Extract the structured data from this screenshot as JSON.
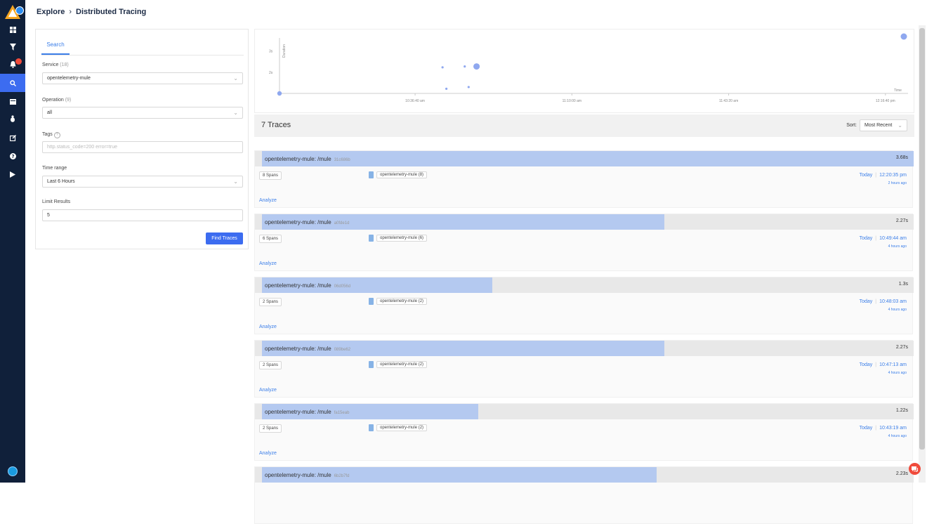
{
  "breadcrumb": {
    "root": "Explore",
    "separator": "›",
    "current": "Distributed Tracing"
  },
  "sidebar": {
    "items": [
      {
        "name": "dashboard-icon"
      },
      {
        "name": "filter-icon"
      },
      {
        "name": "alerts-bell-icon"
      },
      {
        "name": "search-icon",
        "active": true
      },
      {
        "name": "calendar-icon"
      },
      {
        "name": "bug-icon"
      },
      {
        "name": "edit-icon"
      },
      {
        "name": "help-icon"
      },
      {
        "name": "play-icon"
      }
    ]
  },
  "search": {
    "tab_label": "Search",
    "service_label": "Service",
    "service_count": "(18)",
    "service_value": "opentelemetry-mule",
    "operation_label": "Operation",
    "operation_count": "(9)",
    "operation_value": "all",
    "tags_label": "Tags",
    "tags_help": "?",
    "tags_placeholder": "http.status_code=200 error=true",
    "time_range_label": "Time range",
    "time_range_value": "Last 6 Hours",
    "limit_label": "Limit Results",
    "limit_value": "5",
    "find_button": "Find Traces"
  },
  "chart_data": {
    "type": "scatter",
    "ylabel": "Duration",
    "xlabel": "Time",
    "y_ticks": [
      "2s",
      "3s"
    ],
    "x_ticks": [
      "10:36:40 am",
      "11:10:00 am",
      "11:43:20 am",
      "12:16:40 pm"
    ],
    "points": [
      {
        "x": "10:07:50 am",
        "y": 1.0,
        "size": "medium"
      },
      {
        "x": "10:43:19 am",
        "y": 1.22,
        "size": "small"
      },
      {
        "x": "10:47:13 am",
        "y": 2.27,
        "size": "small"
      },
      {
        "x": "10:48:03 am",
        "y": 1.3,
        "size": "small"
      },
      {
        "x": "10:49:44 am",
        "y": 2.27,
        "size": "large"
      },
      {
        "x": "10:42:30 am",
        "y": 2.23,
        "size": "small"
      },
      {
        "x": "12:20:35 pm",
        "y": 3.68,
        "size": "large"
      }
    ],
    "color": "#8fa8ef"
  },
  "traces_header": {
    "count_label": "7 Traces",
    "sort_label": "Sort:",
    "sort_value": "Most Recent"
  },
  "traces": [
    {
      "title": "opentelemetry-mule: /mule",
      "id": "31c686b",
      "duration": "3.68s",
      "fill": 1.0,
      "spans": "8 Spans",
      "service": "opentelemetry-mule (8)",
      "day": "Today",
      "time": "12:20:35 pm",
      "ago": "2 hours ago",
      "analyze": "Analyze"
    },
    {
      "title": "opentelemetry-mule: /mule",
      "id": "a0fde1d",
      "duration": "2.27s",
      "fill": 0.617,
      "spans": "6 Spans",
      "service": "opentelemetry-mule (6)",
      "day": "Today",
      "time": "10:49:44 am",
      "ago": "4 hours ago",
      "analyze": "Analyze"
    },
    {
      "title": "opentelemetry-mule: /mule",
      "id": "06d056d",
      "duration": "1.3s",
      "fill": 0.353,
      "spans": "2 Spans",
      "service": "opentelemetry-mule (2)",
      "day": "Today",
      "time": "10:48:03 am",
      "ago": "4 hours ago",
      "analyze": "Analyze"
    },
    {
      "title": "opentelemetry-mule: /mule",
      "id": "089be62",
      "duration": "2.27s",
      "fill": 0.617,
      "spans": "2 Spans",
      "service": "opentelemetry-mule (2)",
      "day": "Today",
      "time": "10:47:13 am",
      "ago": "4 hours ago",
      "analyze": "Analyze"
    },
    {
      "title": "opentelemetry-mule: /mule",
      "id": "fa15eab",
      "duration": "1.22s",
      "fill": 0.332,
      "spans": "2 Spans",
      "service": "opentelemetry-mule (2)",
      "day": "Today",
      "time": "10:43:19 am",
      "ago": "4 hours ago",
      "analyze": "Analyze"
    },
    {
      "title": "opentelemetry-mule: /mule",
      "id": "6b2b7fd",
      "duration": "2.23s",
      "fill": 0.606
    }
  ]
}
